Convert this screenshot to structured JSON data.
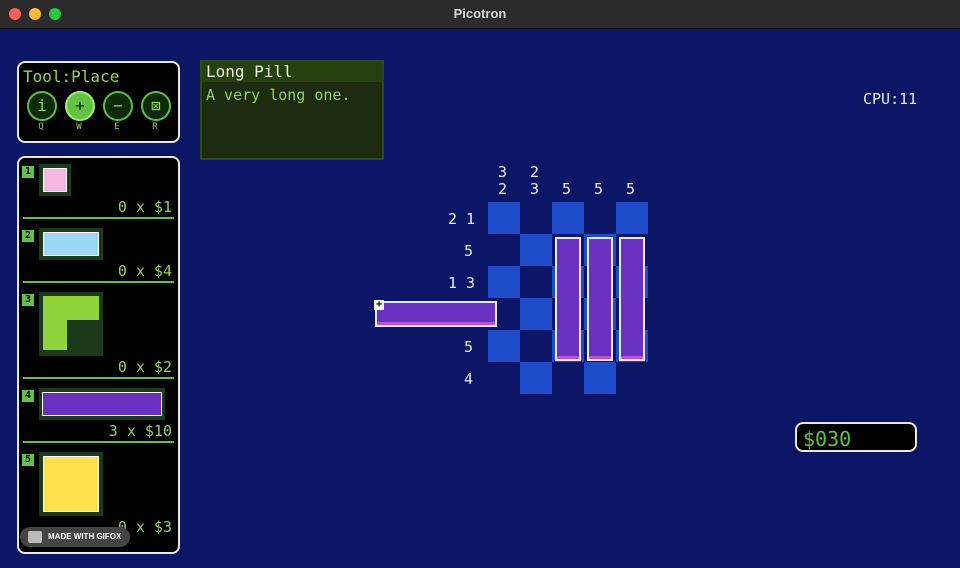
{
  "window": {
    "title": "Picotron"
  },
  "tools": {
    "label": "Tool:Place",
    "buttons": [
      {
        "name": "info",
        "glyph": "i",
        "key": "Q"
      },
      {
        "name": "place",
        "glyph": "+",
        "key": "W",
        "active": true
      },
      {
        "name": "remove",
        "glyph": "−",
        "key": "E"
      },
      {
        "name": "cross",
        "glyph": "⊠",
        "key": "R"
      }
    ]
  },
  "inventory": [
    {
      "num": "1",
      "count_price": "0 x $1",
      "color": "#f4b6e2"
    },
    {
      "num": "2",
      "count_price": "0 x $4",
      "color": "#9ed6f5"
    },
    {
      "num": "3",
      "count_price": "0 x $2",
      "color": "#8fd43c"
    },
    {
      "num": "4",
      "count_price": "3 x $10",
      "color": "#6a30c0"
    },
    {
      "num": "5",
      "count_price": "0 x $3",
      "color": "#ffe14f"
    }
  ],
  "info": {
    "title": "Long Pill",
    "description": "A very long one."
  },
  "cpu": "CPU:11",
  "money": "$030",
  "puzzle": {
    "col_clues": [
      [
        "3",
        "2"
      ],
      [
        "2",
        "3"
      ],
      [
        "5"
      ],
      [
        "5"
      ],
      [
        "5"
      ]
    ],
    "row_clues": [
      "2 1",
      "5",
      "1 3",
      "",
      "5",
      "4"
    ]
  },
  "watermark": "MADE WITH GIFOX"
}
